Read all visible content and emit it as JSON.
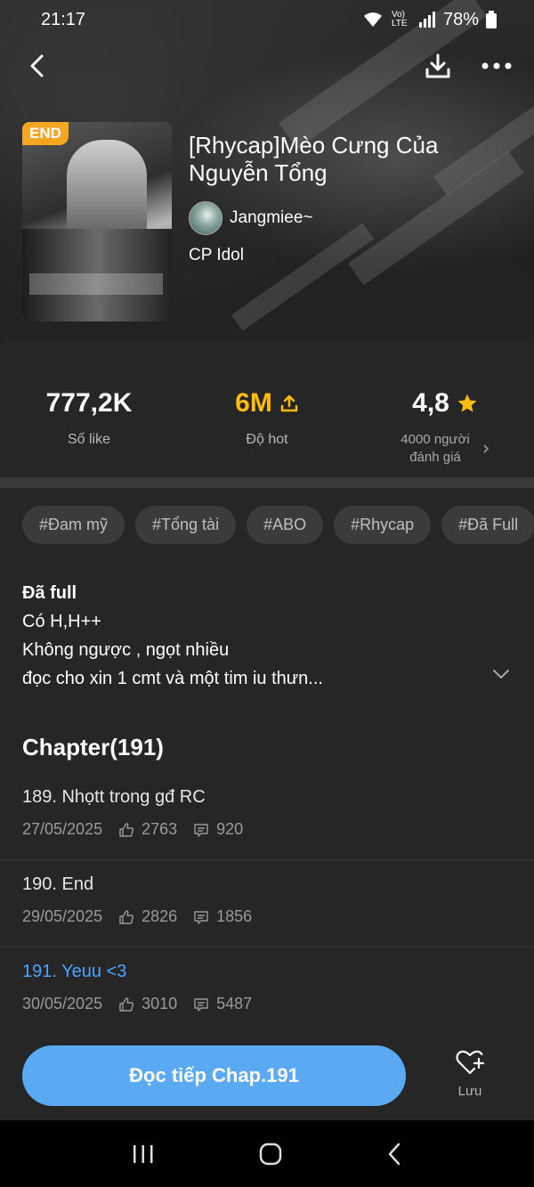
{
  "status_bar": {
    "time": "21:17",
    "battery": "78%",
    "network": "Vo) LTE"
  },
  "nav": {
    "back_icon": "back-arrow-icon",
    "download_icon": "download-icon",
    "more_icon": "more-dots-icon"
  },
  "book": {
    "badge": "END",
    "title": "[Rhycap]Mèo Cưng Của Nguyễn Tổng",
    "author": "Jangmiee~",
    "category": "CP Idol"
  },
  "stats": {
    "likes": {
      "value": "777,2K",
      "label": "Số like"
    },
    "hot": {
      "value": "6M",
      "label": "Độ hot"
    },
    "rating": {
      "value": "4,8",
      "label_line1": "4000 người",
      "label_line2": "đánh giá"
    }
  },
  "tags": [
    "#Đam mỹ",
    "#Tổng tài",
    "#ABO",
    "#Rhycap",
    "#Đã Full"
  ],
  "description": {
    "line1": "Đã full",
    "line2": "Có H,H++",
    "line3": "Không ngược , ngọt nhiều",
    "line4": "đọc cho xin 1 cmt và một tim iu thưn..."
  },
  "chapters": {
    "heading": "Chapter(191)",
    "items": [
      {
        "title": "189. Nhọtt trong gđ RC",
        "date": "27/05/2025",
        "likes": "2763",
        "comments": "920"
      },
      {
        "title": "190. End",
        "date": "29/05/2025",
        "likes": "2826",
        "comments": "1856"
      },
      {
        "title": "191. Yeuu <3",
        "date": "30/05/2025",
        "likes": "3010",
        "comments": "5487"
      }
    ]
  },
  "actions": {
    "read_label": "Đọc tiếp Chap.191",
    "save_label": "Lưu"
  },
  "colors": {
    "accent": "#5aaaf3",
    "hot": "#ffbc0d",
    "badge": "#f5a623",
    "active_chapter": "#4aa3ff"
  }
}
